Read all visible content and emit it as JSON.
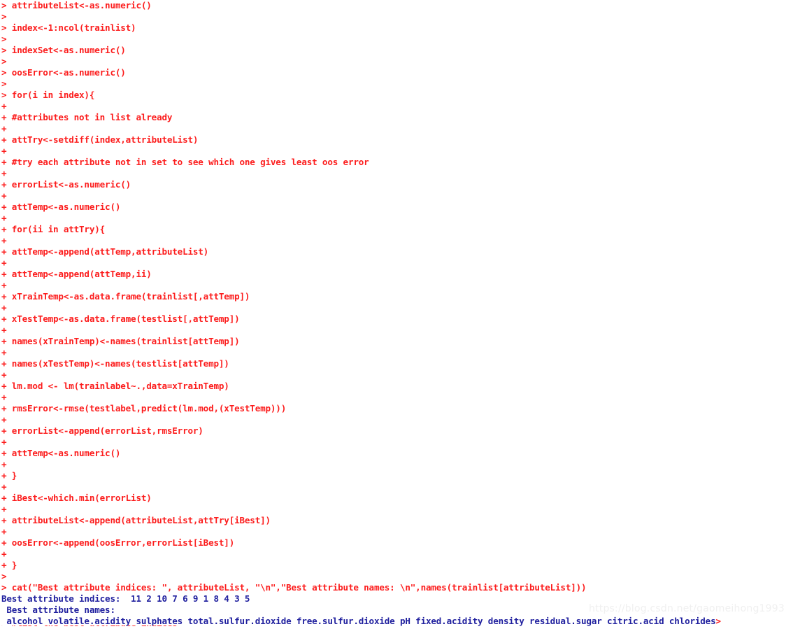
{
  "console": {
    "app": "R Console",
    "prompt_symbol": ">",
    "continuation_symbol": "+",
    "colors": {
      "command_red": "#fc1d1d",
      "output_blue": "#1f1f9e",
      "background": "#ffffff",
      "watermark_gray": "#f0f0f0"
    },
    "lines": [
      {
        "kind": "cmd",
        "text": "> attributeList<-as.numeric()"
      },
      {
        "kind": "cmd",
        "text": ">"
      },
      {
        "kind": "cmd",
        "text": "> index<-1:ncol(trainlist)"
      },
      {
        "kind": "cmd",
        "text": ">"
      },
      {
        "kind": "cmd",
        "text": "> indexSet<-as.numeric()"
      },
      {
        "kind": "cmd",
        "text": ">"
      },
      {
        "kind": "cmd",
        "text": "> oosError<-as.numeric()"
      },
      {
        "kind": "cmd",
        "text": ">"
      },
      {
        "kind": "cmd",
        "text": "> for(i in index){"
      },
      {
        "kind": "cmd",
        "text": "+"
      },
      {
        "kind": "cmd",
        "text": "+ #attributes not in list already"
      },
      {
        "kind": "cmd",
        "text": "+"
      },
      {
        "kind": "cmd",
        "text": "+ attTry<-setdiff(index,attributeList)"
      },
      {
        "kind": "cmd",
        "text": "+"
      },
      {
        "kind": "cmd",
        "text": "+ #try each attribute not in set to see which one gives least oos error"
      },
      {
        "kind": "cmd",
        "text": "+"
      },
      {
        "kind": "cmd",
        "text": "+ errorList<-as.numeric()"
      },
      {
        "kind": "cmd",
        "text": "+"
      },
      {
        "kind": "cmd",
        "text": "+ attTemp<-as.numeric()"
      },
      {
        "kind": "cmd",
        "text": "+"
      },
      {
        "kind": "cmd",
        "text": "+ for(ii in attTry){"
      },
      {
        "kind": "cmd",
        "text": "+"
      },
      {
        "kind": "cmd",
        "text": "+ attTemp<-append(attTemp,attributeList)"
      },
      {
        "kind": "cmd",
        "text": "+"
      },
      {
        "kind": "cmd",
        "text": "+ attTemp<-append(attTemp,ii)"
      },
      {
        "kind": "cmd",
        "text": "+"
      },
      {
        "kind": "cmd",
        "text": "+ xTrainTemp<-as.data.frame(trainlist[,attTemp])"
      },
      {
        "kind": "cmd",
        "text": "+"
      },
      {
        "kind": "cmd",
        "text": "+ xTestTemp<-as.data.frame(testlist[,attTemp])"
      },
      {
        "kind": "cmd",
        "text": "+"
      },
      {
        "kind": "cmd",
        "text": "+ names(xTrainTemp)<-names(trainlist[attTemp])"
      },
      {
        "kind": "cmd",
        "text": "+"
      },
      {
        "kind": "cmd",
        "text": "+ names(xTestTemp)<-names(testlist[attTemp])"
      },
      {
        "kind": "cmd",
        "text": "+"
      },
      {
        "kind": "cmd",
        "text": "+ lm.mod <- lm(trainlabel~.,data=xTrainTemp)"
      },
      {
        "kind": "cmd",
        "text": "+"
      },
      {
        "kind": "cmd",
        "text": "+ rmsError<-rmse(testlabel,predict(lm.mod,(xTestTemp)))"
      },
      {
        "kind": "cmd",
        "text": "+"
      },
      {
        "kind": "cmd",
        "text": "+ errorList<-append(errorList,rmsError)"
      },
      {
        "kind": "cmd",
        "text": "+"
      },
      {
        "kind": "cmd",
        "text": "+ attTemp<-as.numeric()"
      },
      {
        "kind": "cmd",
        "text": "+"
      },
      {
        "kind": "cmd",
        "text": "+ }"
      },
      {
        "kind": "cmd",
        "text": "+"
      },
      {
        "kind": "cmd",
        "text": "+ iBest<-which.min(errorList)"
      },
      {
        "kind": "cmd",
        "text": "+"
      },
      {
        "kind": "cmd",
        "text": "+ attributeList<-append(attributeList,attTry[iBest])"
      },
      {
        "kind": "cmd",
        "text": "+"
      },
      {
        "kind": "cmd",
        "text": "+ oosError<-append(oosError,errorList[iBest])"
      },
      {
        "kind": "cmd",
        "text": "+"
      },
      {
        "kind": "cmd",
        "text": "+ }"
      },
      {
        "kind": "cmd",
        "text": ">"
      },
      {
        "kind": "cmd",
        "text": "> cat(\"Best attribute indices: \", attributeList, \"\\n\",\"Best attribute names: \\n\",names(trainlist[attributeList]))"
      },
      {
        "kind": "out",
        "text": "Best attribute indices:  11 2 10 7 6 9 1 8 4 3 5"
      },
      {
        "kind": "out",
        "text": " Best attribute names:"
      },
      {
        "kind": "mixed",
        "text": " alcohol volatile.acidity sulphates total.sulfur.dioxide free.sulfur.dioxide pH fixed.acidity density residual.sugar citric.acid chlorides",
        "tail": ">"
      }
    ],
    "clipped_line": {
      "kind": "cmd",
      "text": "> #list the best attribute indices"
    },
    "results": {
      "best_attribute_indices_label": "Best attribute indices:",
      "best_attribute_indices": [
        11,
        2,
        10,
        7,
        6,
        9,
        1,
        8,
        4,
        3,
        5
      ],
      "best_attribute_names_label": "Best attribute names:",
      "best_attribute_names": [
        "alcohol",
        "volatile.acidity",
        "sulphates",
        "total.sulfur.dioxide",
        "free.sulfur.dioxide",
        "pH",
        "fixed.acidity",
        "density",
        "residual.sugar",
        "citric.acid",
        "chlorides"
      ]
    }
  },
  "watermark": {
    "text": "https://blog.csdn.net/gaomeihong1993"
  }
}
